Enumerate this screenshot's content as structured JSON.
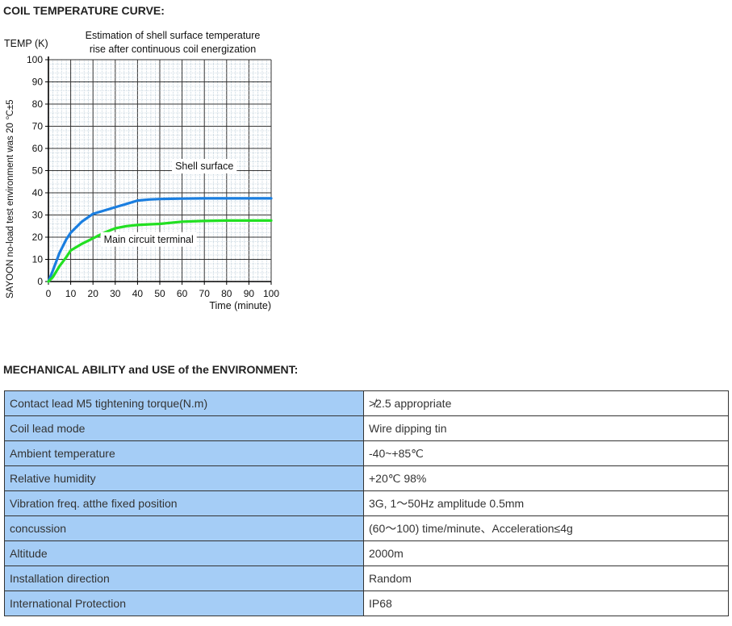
{
  "sections": {
    "coil_title": "COIL TEMPERATURE CURVE:",
    "mech_title": "MECHANICAL ABILITY and USE of the ENVIRONMENT:"
  },
  "chart_data": {
    "type": "line",
    "title_lines": [
      "Estimation of shell surface temperature",
      "rise after continuous coil energization"
    ],
    "ylabel": "TEMP (K)",
    "xlabel": "Time (minute)",
    "side_label": "SAYOON no-load test environment was 20 ℃±5",
    "xlim": [
      0,
      100
    ],
    "ylim": [
      0,
      100
    ],
    "xticks": [
      0,
      10,
      20,
      30,
      40,
      50,
      60,
      70,
      80,
      90,
      100
    ],
    "yticks": [
      0,
      10,
      20,
      30,
      40,
      50,
      60,
      70,
      80,
      90,
      100
    ],
    "grid": true,
    "series": [
      {
        "name": "Shell surface",
        "color": "#1a7ee0",
        "x": [
          0,
          2,
          5,
          8,
          10,
          15,
          20,
          25,
          30,
          35,
          40,
          45,
          50,
          55,
          60,
          70,
          80,
          90,
          100
        ],
        "y": [
          0,
          5,
          13,
          19,
          22,
          27,
          30.5,
          32,
          33.5,
          35,
          36.5,
          37,
          37.2,
          37.3,
          37.4,
          37.5,
          37.5,
          37.5,
          37.5
        ]
      },
      {
        "name": "Main circuit terminal",
        "color": "#22e022",
        "x": [
          0,
          2,
          5,
          8,
          10,
          15,
          20,
          25,
          30,
          35,
          40,
          45,
          50,
          60,
          70,
          80,
          90,
          100
        ],
        "y": [
          0,
          2,
          7,
          11,
          14,
          17,
          19.5,
          22,
          24,
          25,
          25.5,
          25.8,
          26,
          27,
          27.3,
          27.5,
          27.5,
          27.5
        ]
      }
    ]
  },
  "specs": [
    {
      "key": "Contact lead M5 tightening torque(N.m)",
      "value": "≯2.5 appropriate"
    },
    {
      "key": "Coil lead mode",
      "value": "Wire dipping tin"
    },
    {
      "key": "Ambient temperature",
      "value": "-40~+85℃"
    },
    {
      "key": "Relative humidity",
      "value": "+20℃ 98%"
    },
    {
      "key": "Vibration freq. atthe fixed position",
      "value": "3G, 1～50Hz amplitude 0.5mm"
    },
    {
      "key": "concussion",
      "value": "(60～100) time/minute、Acceleration≤4g"
    },
    {
      "key": "Altitude",
      "value": "2000m"
    },
    {
      "key": "Installation direction",
      "value": "Random"
    },
    {
      "key": "International Protection",
      "value": "IP68"
    }
  ]
}
